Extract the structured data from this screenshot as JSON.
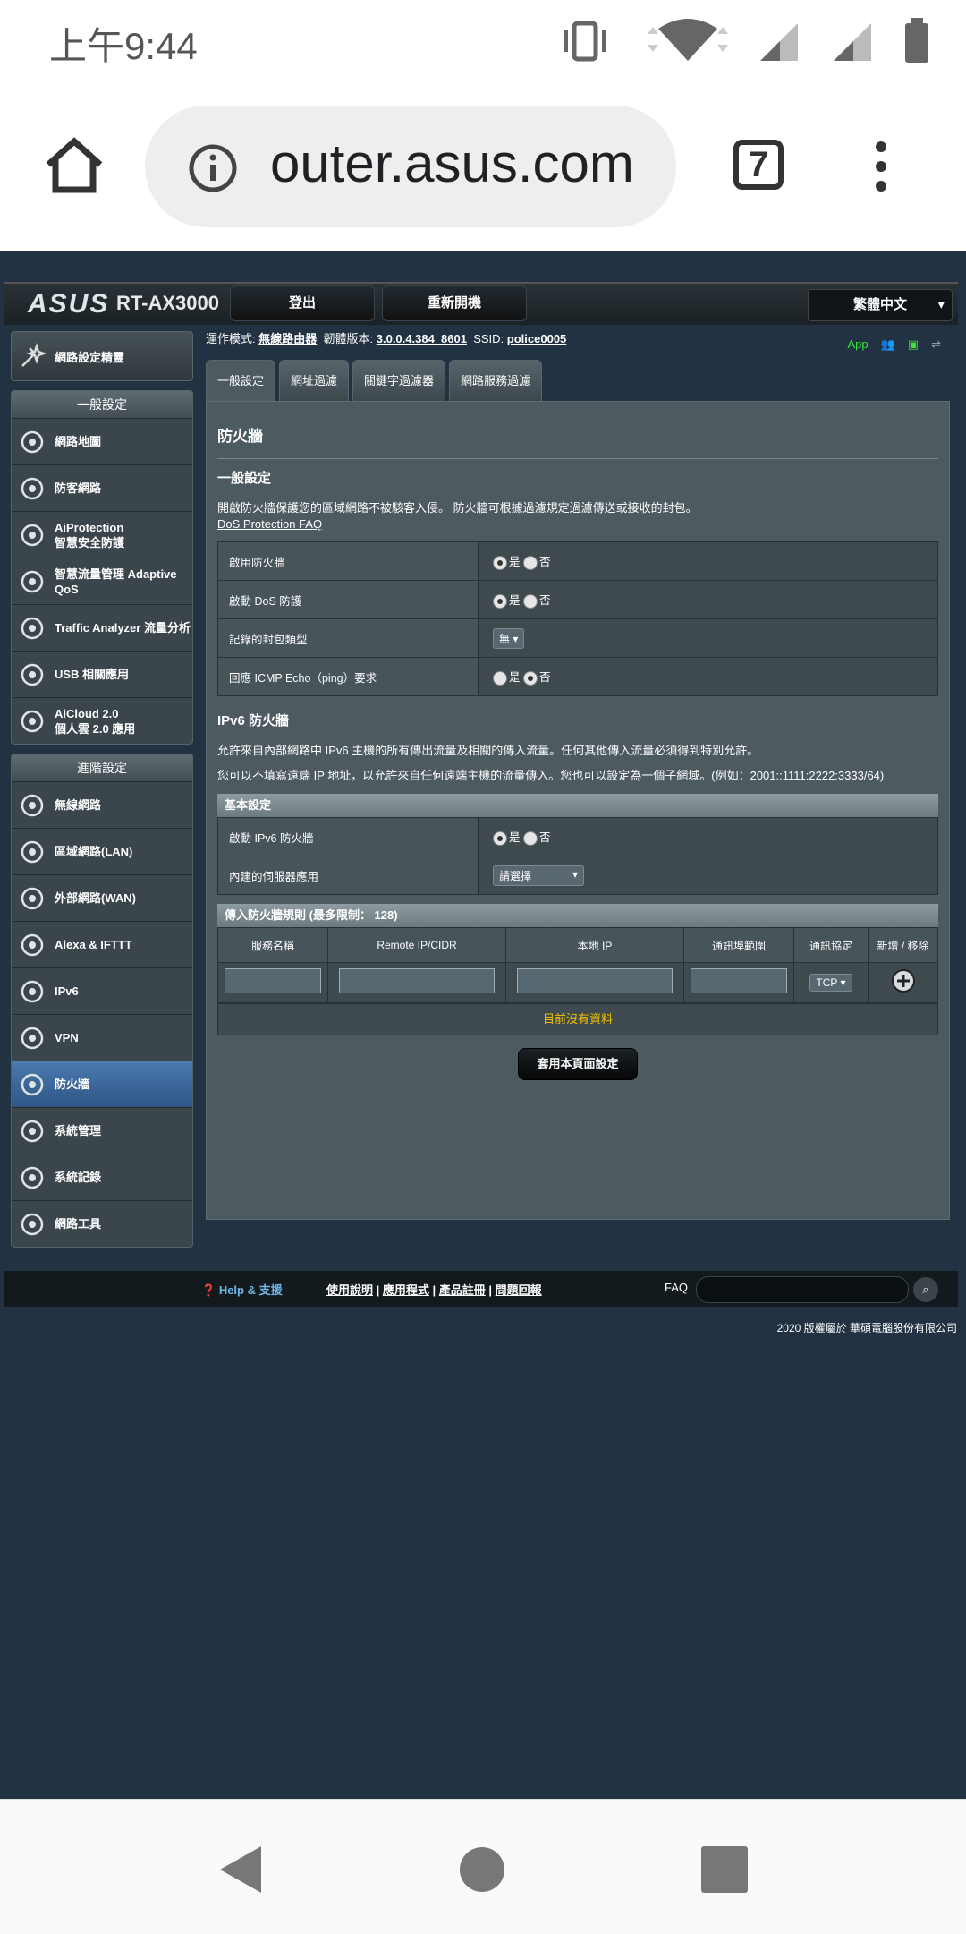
{
  "status_bar": {
    "time": "上午9:44"
  },
  "browser": {
    "url": "outer.asus.com",
    "tab_count": "7"
  },
  "header": {
    "brand": "ASUS",
    "model": "RT-AX3000",
    "logout": "登出",
    "reboot": "重新開機",
    "language": "繁體中文"
  },
  "sidebar": {
    "wizard": "網路設定精靈",
    "general_title": "一般設定",
    "general_items": [
      {
        "label": "網路地圖",
        "icon": "network-map-icon"
      },
      {
        "label": "防客網路",
        "icon": "guest-network-icon"
      },
      {
        "label": "AiProtection\n智慧安全防護",
        "icon": "aiprotection-icon"
      },
      {
        "label": "智慧流量管理 Adaptive QoS",
        "icon": "qos-icon"
      },
      {
        "label": "Traffic Analyzer 流量分析",
        "icon": "traffic-analyzer-icon"
      },
      {
        "label": "USB 相關應用",
        "icon": "usb-icon"
      },
      {
        "label": "AiCloud 2.0\n個人雲 2.0 應用",
        "icon": "aicloud-icon"
      }
    ],
    "advanced_title": "進階設定",
    "advanced_items": [
      {
        "label": "無線網路",
        "icon": "wireless-icon"
      },
      {
        "label": "區域網路(LAN)",
        "icon": "lan-icon"
      },
      {
        "label": "外部網路(WAN)",
        "icon": "wan-icon"
      },
      {
        "label": "Alexa & IFTTT",
        "icon": "alexa-icon"
      },
      {
        "label": "IPv6",
        "icon": "ipv6-icon"
      },
      {
        "label": "VPN",
        "icon": "vpn-icon"
      },
      {
        "label": "防火牆",
        "icon": "firewall-icon",
        "active": true
      },
      {
        "label": "系統管理",
        "icon": "admin-icon"
      },
      {
        "label": "系統記錄",
        "icon": "syslog-icon"
      },
      {
        "label": "網路工具",
        "icon": "network-tools-icon"
      }
    ]
  },
  "opbar": {
    "mode_label": "運作模式:",
    "mode_value": "無線路由器",
    "fw_label": "韌體版本:",
    "fw_value": "3.0.0.4.384_8601",
    "ssid_label": "SSID:",
    "ssid_value": "police0005",
    "app_label": "App"
  },
  "tabs": [
    "一般設定",
    "網址過濾",
    "關鍵字過濾器",
    "網路服務過濾"
  ],
  "content": {
    "page_title": "防火牆",
    "general_title": "一般設定",
    "general_desc": "開啟防火牆保護您的區域網路不被駭客入侵。 防火牆可根據過濾規定過濾傳送或接收的封包。",
    "faq_link": "DoS Protection FAQ",
    "yes": "是",
    "no": "否",
    "rows": [
      {
        "label": "啟用防火牆"
      },
      {
        "label": "啟動 DoS 防護"
      },
      {
        "label": "記錄的封包類型",
        "select": "無"
      },
      {
        "label": "回應 ICMP Echo（ping）要求"
      }
    ],
    "ipv6_title": "IPv6 防火牆",
    "ipv6_desc1": "允許來自內部網路中 IPv6 主機的所有傳出流量及相關的傳入流量。任何其他傳入流量必須得到特別允許。",
    "ipv6_desc2": "您可以不填寫遠端 IP 地址，以允許來自任何遠端主機的流量傳入。您也可以設定為一個子網域。(例如：2001::1111:2222:3333/64)",
    "basic_band": "基本設定",
    "ipv6_enable": "啟動 IPv6 防火牆",
    "server_app": "內建的伺服器應用",
    "server_app_select": "請選擇",
    "rules_band": "傳入防火牆規則 (最多限制： 128)",
    "rule_headers": [
      "服務名稱",
      "Remote IP/CIDR",
      "本地 IP",
      "通訊埠範圍",
      "通訊協定",
      "新增 / 移除"
    ],
    "protocol": "TCP",
    "no_data": "目前沒有資料",
    "apply": "套用本頁面設定"
  },
  "footer": {
    "help": "Help & 支援",
    "manual": "使用說明",
    "utility": "應用程式",
    "register": "產品註冊",
    "feedback": "問題回報",
    "faq": "FAQ",
    "copyright": "2020 版權屬於 華碩電腦股份有限公司"
  }
}
